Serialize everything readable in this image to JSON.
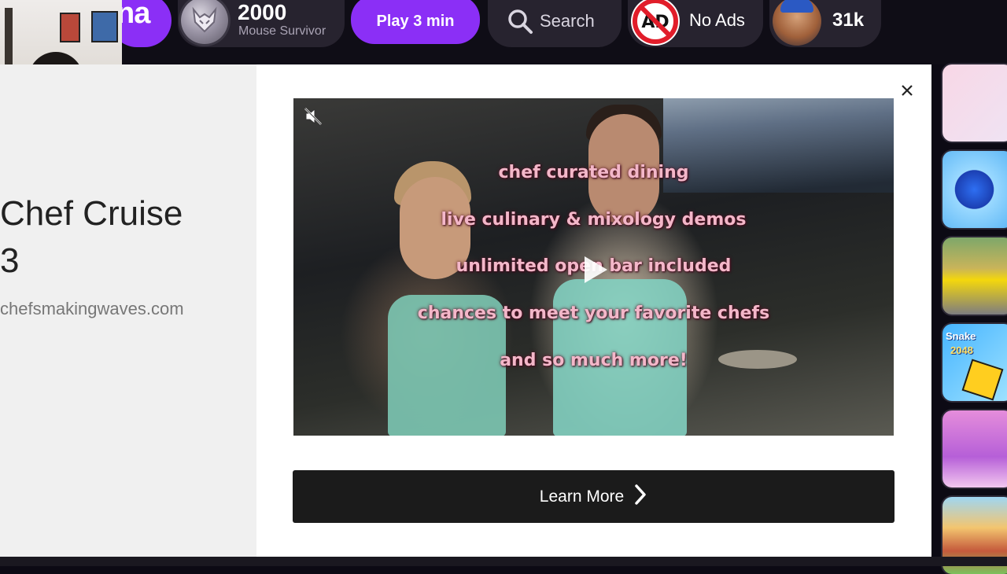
{
  "topbar": {
    "logo_text": "na",
    "badge": {
      "score": "2000",
      "game_name": "Mouse Survivor"
    },
    "play_button": "Play 3 min",
    "search_label": "Search",
    "noads_label": "No Ads",
    "noads_icon_text": "AD",
    "user_count": "31k"
  },
  "left": {
    "ad_title_line1": "Chef Cruise",
    "ad_title_line2": "3",
    "ad_domain": "chefsmakingwaves.com"
  },
  "modal": {
    "close_symbol": "×",
    "video": {
      "overlay_lines": [
        "chef curated dining",
        "live culinary & mixology demos",
        "unlimited open bar included",
        "chances to meet your favorite chefs",
        "and so much more!"
      ]
    },
    "learn_more_label": "Learn More"
  },
  "thumbnails": {
    "snake_title": "Snake",
    "snake_sub": "2048"
  },
  "colors": {
    "accent_purple": "#8b2ff6",
    "topbar_bg": "#0f0d16",
    "pill_bg": "#27232f",
    "overlay_text": "#f3b7c9",
    "button_dark": "#1b1b1b"
  },
  "icons": [
    "fox-badge-icon",
    "search-icon",
    "no-ads-icon",
    "avatar",
    "close-icon",
    "mute-icon",
    "play-icon",
    "chevron-right-icon"
  ]
}
